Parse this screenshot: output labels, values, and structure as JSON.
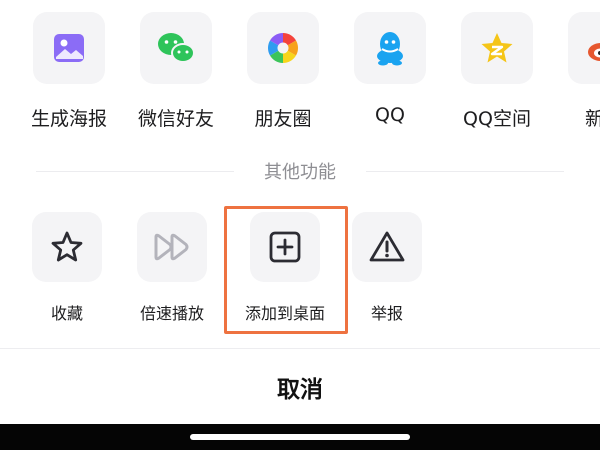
{
  "share_targets": [
    {
      "label": "生成海报",
      "icon": "poster-icon"
    },
    {
      "label": "微信好友",
      "icon": "wechat-icon"
    },
    {
      "label": "朋友圈",
      "icon": "moments-icon"
    },
    {
      "label": "QQ",
      "icon": "qq-icon"
    },
    {
      "label": "QQ空间",
      "icon": "qzone-icon"
    },
    {
      "label": "新浪",
      "icon": "weibo-icon"
    }
  ],
  "section_title": "其他功能",
  "functions": [
    {
      "label": "收藏",
      "icon": "star-icon"
    },
    {
      "label": "倍速播放",
      "icon": "fast-forward-icon"
    },
    {
      "label": "添加到桌面",
      "icon": "add-square-icon"
    },
    {
      "label": "举报",
      "icon": "warning-icon"
    }
  ],
  "cancel_label": "取消",
  "colors": {
    "highlight": "#ee7240",
    "poster": "#8b6cf6",
    "wechat": "#2ec45a",
    "qq": "#1aa3f0",
    "qzone": "#f5c518",
    "weibo": "#e6572f"
  }
}
